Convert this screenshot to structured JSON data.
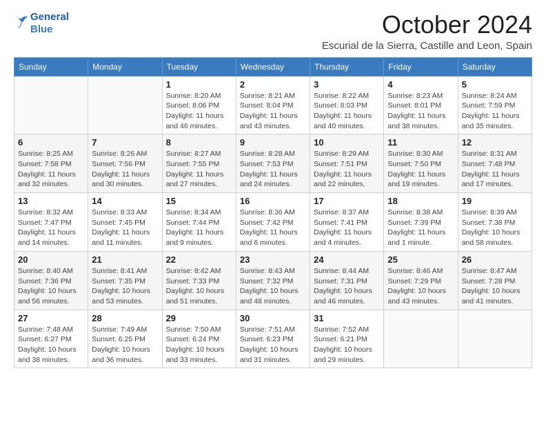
{
  "header": {
    "logo_line1": "General",
    "logo_line2": "Blue",
    "month": "October 2024",
    "location": "Escurial de la Sierra, Castille and Leon, Spain"
  },
  "weekdays": [
    "Sunday",
    "Monday",
    "Tuesday",
    "Wednesday",
    "Thursday",
    "Friday",
    "Saturday"
  ],
  "weeks": [
    [
      {
        "day": "",
        "info": ""
      },
      {
        "day": "",
        "info": ""
      },
      {
        "day": "1",
        "info": "Sunrise: 8:20 AM\nSunset: 8:06 PM\nDaylight: 11 hours and 46 minutes."
      },
      {
        "day": "2",
        "info": "Sunrise: 8:21 AM\nSunset: 8:04 PM\nDaylight: 11 hours and 43 minutes."
      },
      {
        "day": "3",
        "info": "Sunrise: 8:22 AM\nSunset: 8:03 PM\nDaylight: 11 hours and 40 minutes."
      },
      {
        "day": "4",
        "info": "Sunrise: 8:23 AM\nSunset: 8:01 PM\nDaylight: 11 hours and 38 minutes."
      },
      {
        "day": "5",
        "info": "Sunrise: 8:24 AM\nSunset: 7:59 PM\nDaylight: 11 hours and 35 minutes."
      }
    ],
    [
      {
        "day": "6",
        "info": "Sunrise: 8:25 AM\nSunset: 7:58 PM\nDaylight: 11 hours and 32 minutes."
      },
      {
        "day": "7",
        "info": "Sunrise: 8:26 AM\nSunset: 7:56 PM\nDaylight: 11 hours and 30 minutes."
      },
      {
        "day": "8",
        "info": "Sunrise: 8:27 AM\nSunset: 7:55 PM\nDaylight: 11 hours and 27 minutes."
      },
      {
        "day": "9",
        "info": "Sunrise: 8:28 AM\nSunset: 7:53 PM\nDaylight: 11 hours and 24 minutes."
      },
      {
        "day": "10",
        "info": "Sunrise: 8:29 AM\nSunset: 7:51 PM\nDaylight: 11 hours and 22 minutes."
      },
      {
        "day": "11",
        "info": "Sunrise: 8:30 AM\nSunset: 7:50 PM\nDaylight: 11 hours and 19 minutes."
      },
      {
        "day": "12",
        "info": "Sunrise: 8:31 AM\nSunset: 7:48 PM\nDaylight: 11 hours and 17 minutes."
      }
    ],
    [
      {
        "day": "13",
        "info": "Sunrise: 8:32 AM\nSunset: 7:47 PM\nDaylight: 11 hours and 14 minutes."
      },
      {
        "day": "14",
        "info": "Sunrise: 8:33 AM\nSunset: 7:45 PM\nDaylight: 11 hours and 11 minutes."
      },
      {
        "day": "15",
        "info": "Sunrise: 8:34 AM\nSunset: 7:44 PM\nDaylight: 11 hours and 9 minutes."
      },
      {
        "day": "16",
        "info": "Sunrise: 8:36 AM\nSunset: 7:42 PM\nDaylight: 11 hours and 6 minutes."
      },
      {
        "day": "17",
        "info": "Sunrise: 8:37 AM\nSunset: 7:41 PM\nDaylight: 11 hours and 4 minutes."
      },
      {
        "day": "18",
        "info": "Sunrise: 8:38 AM\nSunset: 7:39 PM\nDaylight: 11 hours and 1 minute."
      },
      {
        "day": "19",
        "info": "Sunrise: 8:39 AM\nSunset: 7:38 PM\nDaylight: 10 hours and 58 minutes."
      }
    ],
    [
      {
        "day": "20",
        "info": "Sunrise: 8:40 AM\nSunset: 7:36 PM\nDaylight: 10 hours and 56 minutes."
      },
      {
        "day": "21",
        "info": "Sunrise: 8:41 AM\nSunset: 7:35 PM\nDaylight: 10 hours and 53 minutes."
      },
      {
        "day": "22",
        "info": "Sunrise: 8:42 AM\nSunset: 7:33 PM\nDaylight: 10 hours and 51 minutes."
      },
      {
        "day": "23",
        "info": "Sunrise: 8:43 AM\nSunset: 7:32 PM\nDaylight: 10 hours and 48 minutes."
      },
      {
        "day": "24",
        "info": "Sunrise: 8:44 AM\nSunset: 7:31 PM\nDaylight: 10 hours and 46 minutes."
      },
      {
        "day": "25",
        "info": "Sunrise: 8:46 AM\nSunset: 7:29 PM\nDaylight: 10 hours and 43 minutes."
      },
      {
        "day": "26",
        "info": "Sunrise: 8:47 AM\nSunset: 7:28 PM\nDaylight: 10 hours and 41 minutes."
      }
    ],
    [
      {
        "day": "27",
        "info": "Sunrise: 7:48 AM\nSunset: 6:27 PM\nDaylight: 10 hours and 38 minutes."
      },
      {
        "day": "28",
        "info": "Sunrise: 7:49 AM\nSunset: 6:25 PM\nDaylight: 10 hours and 36 minutes."
      },
      {
        "day": "29",
        "info": "Sunrise: 7:50 AM\nSunset: 6:24 PM\nDaylight: 10 hours and 33 minutes."
      },
      {
        "day": "30",
        "info": "Sunrise: 7:51 AM\nSunset: 6:23 PM\nDaylight: 10 hours and 31 minutes."
      },
      {
        "day": "31",
        "info": "Sunrise: 7:52 AM\nSunset: 6:21 PM\nDaylight: 10 hours and 29 minutes."
      },
      {
        "day": "",
        "info": ""
      },
      {
        "day": "",
        "info": ""
      }
    ]
  ]
}
